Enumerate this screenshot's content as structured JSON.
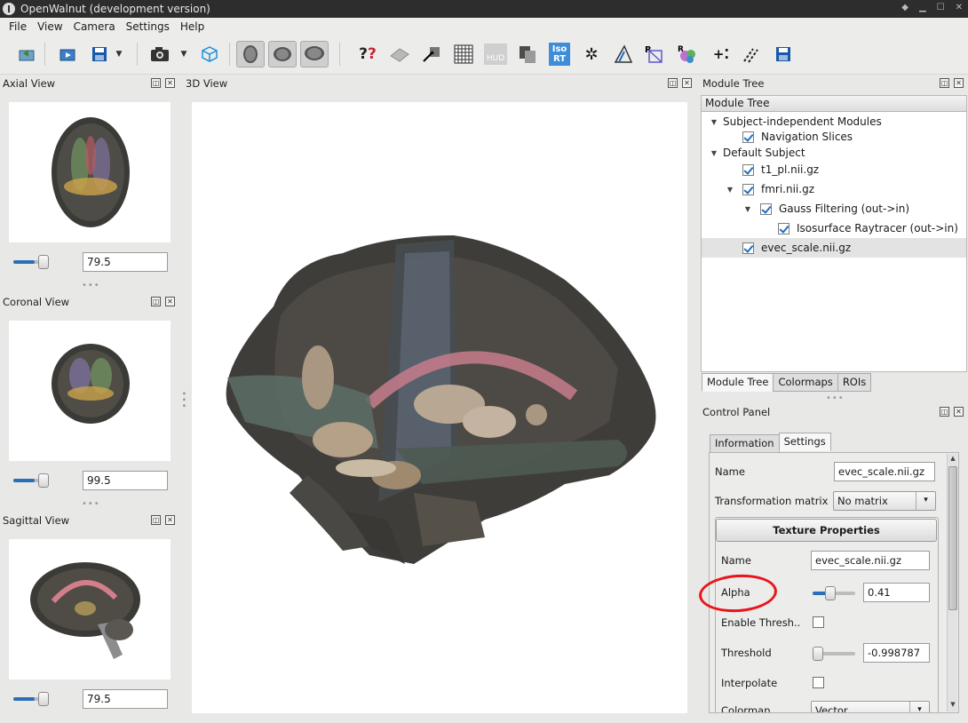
{
  "window": {
    "title": "OpenWalnut (development version)"
  },
  "menu": [
    "File",
    "View",
    "Camera",
    "Settings",
    "Help"
  ],
  "toolbar": {
    "hud_label": "HUD",
    "isort_label_top": "Iso",
    "isort_label_bottom": "RT"
  },
  "left_views": {
    "axial": {
      "title": "Axial View",
      "value": "79.5",
      "slider_fraction": 0.6
    },
    "coronal": {
      "title": "Coronal View",
      "value": "99.5",
      "slider_fraction": 0.6
    },
    "sagittal": {
      "title": "Sagittal View",
      "value": "79.5",
      "slider_fraction": 0.6
    }
  },
  "view3d": {
    "title": "3D View"
  },
  "module_tree": {
    "panel_title": "Module Tree",
    "header": "Module Tree",
    "items": [
      {
        "label": "Subject-independent Modules",
        "checked": null
      },
      {
        "label": "Navigation Slices",
        "checked": true
      },
      {
        "label": "Default Subject",
        "checked": null
      },
      {
        "label": "t1_pl.nii.gz",
        "checked": true
      },
      {
        "label": "fmri.nii.gz",
        "checked": true
      },
      {
        "label": "Gauss Filtering (out->in)",
        "checked": true
      },
      {
        "label": "Isosurface Raytracer (out->in)",
        "checked": true
      },
      {
        "label": "evec_scale.nii.gz",
        "checked": true,
        "selected": true
      }
    ],
    "tabs": [
      "Module Tree",
      "Colormaps",
      "ROIs"
    ],
    "active_tab": "Module Tree"
  },
  "control_panel": {
    "title": "Control Panel",
    "tabs": [
      "Information",
      "Settings"
    ],
    "active_tab": "Settings",
    "name_label": "Name",
    "name_value": "evec_scale.nii.gz",
    "transform_label": "Transformation matrix",
    "transform_value": "No matrix",
    "group_title": "Texture Properties",
    "tex_name_label": "Name",
    "tex_name_value": "evec_scale.nii.gz",
    "alpha_label": "Alpha",
    "alpha_value": "0.41",
    "alpha_fraction": 0.41,
    "thresh_enable_label": "Enable Thresh..",
    "threshold_label": "Threshold",
    "threshold_value": "-0.998787",
    "threshold_fraction": 0.0,
    "interpolate_label": "Interpolate",
    "colormap_label": "Colormap",
    "colormap_value": "Vector"
  },
  "colors": {
    "accent": "#2a6fb6",
    "annotation": "#e8161b",
    "titlebar": "#2d2d2d"
  }
}
